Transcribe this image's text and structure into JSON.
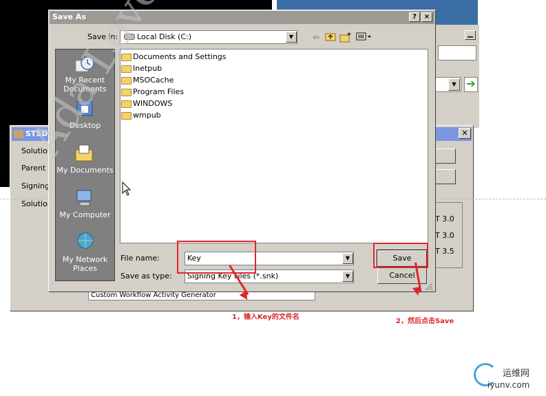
{
  "background": {
    "sts_title": "STSD",
    "sts_labels": [
      "Solution",
      "Parent D",
      "Signing",
      "Solution"
    ],
    "sts_versions": [
      "T 3.0",
      "T 3.0",
      "T 3.5"
    ],
    "generator_field": "Custom Workflow Activity Generator"
  },
  "dialog": {
    "title": "Save As",
    "help_button": "?",
    "close_button": "×",
    "save_in_label": "Save in:",
    "save_in_value": "Local Disk (C:)",
    "places": [
      "My Recent Documents",
      "Desktop",
      "My Documents",
      "My Computer",
      "My Network Places"
    ],
    "files": [
      "Documents and Settings",
      "Inetpub",
      "MSOCache",
      "Program Files",
      "WINDOWS",
      "wmpub"
    ],
    "file_name_label": "File name:",
    "file_name_value": "Key",
    "save_as_type_label": "Save as type:",
    "save_as_type_value": "Signing Key Files (*.snk)",
    "save_button": "Save",
    "cancel_button": "Cancel"
  },
  "annotations": {
    "step1": "1，输入Key的文件名",
    "step2": "2，然后点击Save",
    "color": "#e0262a"
  },
  "watermark": "Ada Lovelace R",
  "logo": {
    "name": "运维网",
    "domain": "iyunv.com",
    "color": "#4aa3d8"
  },
  "icons": {
    "back": "back-arrow-icon",
    "up": "up-folder-icon",
    "new_folder": "new-folder-icon",
    "view": "view-menu-icon"
  }
}
